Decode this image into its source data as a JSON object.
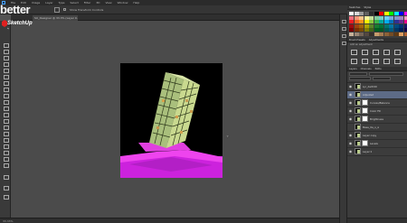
{
  "menubar": {
    "items": [
      "File",
      "Edit",
      "Image",
      "Layer",
      "Type",
      "Select",
      "Filter",
      "3D",
      "View",
      "Window",
      "Help"
    ]
  },
  "options": {
    "show_transform_label": "Show Transform Controls"
  },
  "document": {
    "tab_title": "SU_Designer @ 33.3% (Layer 0, RGB/8)"
  },
  "logo": {
    "word": "better",
    "brand": "SketchUp",
    "tagline": "by"
  },
  "status": {
    "zoom": "33.33%"
  },
  "panels": {
    "swatches_tab": "Swatches",
    "styles_tab": "Styles",
    "adjust_tabs": [
      "Brush Presets",
      "Adjustments"
    ],
    "adjust_hint": "Add an adjustment",
    "layers_tabs": [
      "Layers",
      "Channels",
      "Paths"
    ],
    "swatch_colors": [
      "#ffffff",
      "#d8d8d8",
      "#9b9b9b",
      "#606060",
      "#2c2c2c",
      "#000000",
      "#ff0000",
      "#ffff00",
      "#00ff00",
      "#00ffff",
      "#0000ff",
      "#ff00ff",
      "#f26d7d",
      "#f7977a",
      "#fdc68a",
      "#fff79a",
      "#c4df9b",
      "#82ca9c",
      "#7accc8",
      "#6dcff6",
      "#7ea7d8",
      "#8493ca",
      "#a187be",
      "#f49ac2",
      "#ed1c24",
      "#f26522",
      "#f7941d",
      "#fff200",
      "#8dc63f",
      "#39b54a",
      "#00a99d",
      "#00aeef",
      "#0072bc",
      "#2e3192",
      "#662d91",
      "#ec008c",
      "#9e0b0f",
      "#a0410d",
      "#a36209",
      "#aba000",
      "#598527",
      "#197b30",
      "#007236",
      "#00746b",
      "#0076a3",
      "#004a80",
      "#003471",
      "#1b1464",
      "#790000",
      "#7b2e00",
      "#7d4900",
      "#827b00",
      "#406618",
      "#005e20",
      "#005826",
      "#005952",
      "#005b7f",
      "#003663",
      "#002157",
      "#0d004c",
      "#c7b299",
      "#998675",
      "#736357",
      "#534741",
      "#37302a",
      "#c69c6d",
      "#a67c52",
      "#8c6239",
      "#754c24",
      "#603913",
      "#e0a060",
      "#b06030"
    ],
    "layers": [
      {
        "name": "Lyr_dwfc09",
        "visible": true,
        "selected": false,
        "has_mask": false
      },
      {
        "name": "Adjusted",
        "visible": true,
        "selected": true,
        "has_mask": false
      },
      {
        "name": "Curves/Balance",
        "visible": true,
        "selected": false,
        "has_mask": true
      },
      {
        "name": "Color Fill",
        "visible": true,
        "selected": false,
        "has_mask": true
      },
      {
        "name": "Brightness",
        "visible": true,
        "selected": false,
        "has_mask": true
      },
      {
        "name": "Base_0a_o_sl",
        "visible": false,
        "selected": false,
        "has_mask": false
      },
      {
        "name": "Layer copy",
        "visible": true,
        "selected": false,
        "has_mask": false
      },
      {
        "name": "Levels",
        "visible": true,
        "selected": false,
        "has_mask": true
      },
      {
        "name": "Layer 0",
        "visible": true,
        "selected": false,
        "has_mask": false
      }
    ]
  }
}
